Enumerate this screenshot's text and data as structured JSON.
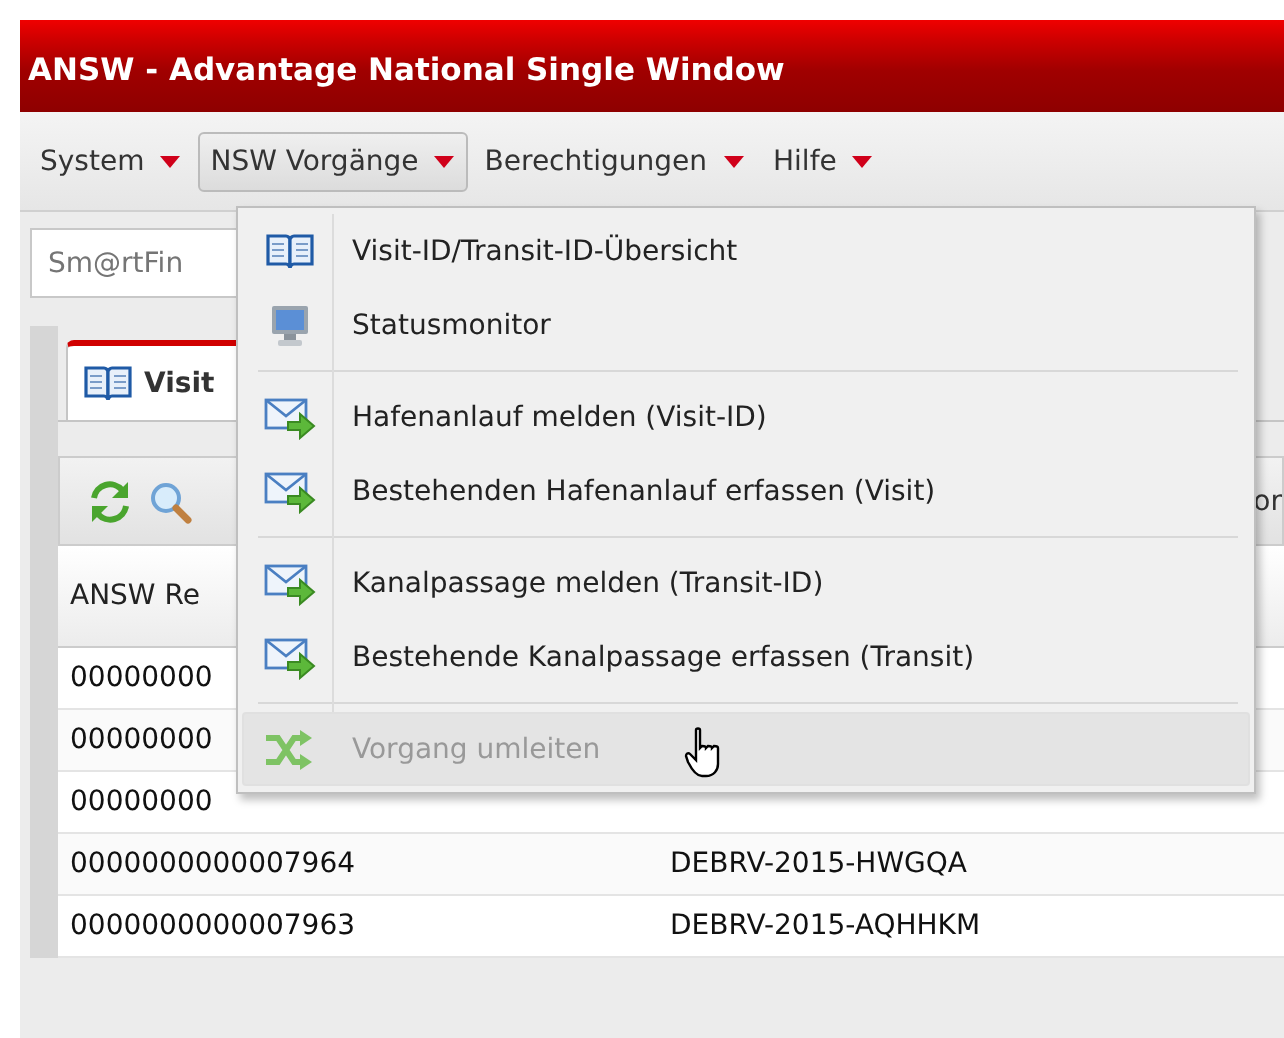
{
  "window": {
    "title": "ANSW - Advantage National Single Window"
  },
  "menubar": [
    {
      "label": "System",
      "selected": false
    },
    {
      "label": "NSW Vorgänge",
      "selected": true
    },
    {
      "label": "Berechtigungen",
      "selected": false
    },
    {
      "label": "Hilfe",
      "selected": false
    }
  ],
  "search": {
    "placeholder": "Sm@rtFin"
  },
  "tab": {
    "label": "Visit"
  },
  "toolbar": {
    "text": "or"
  },
  "table": {
    "columns": [
      "ANSW Re"
    ],
    "rows": [
      [
        "00000000"
      ],
      [
        "00000000"
      ],
      [
        "00000000"
      ],
      [
        "0000000000007964",
        "DEBRV-2015-HWGQA"
      ],
      [
        "0000000000007963",
        "DEBRV-2015-AQHHKM"
      ]
    ]
  },
  "dropdown": [
    {
      "kind": "book",
      "label": "Visit-ID/Transit-ID-Übersicht",
      "disabled": false,
      "highlighted": false
    },
    {
      "kind": "monitor",
      "label": "Statusmonitor",
      "disabled": false,
      "highlighted": false
    },
    {
      "kind": "separator"
    },
    {
      "kind": "mail",
      "label": "Hafenanlauf melden (Visit-ID)",
      "disabled": false,
      "highlighted": false
    },
    {
      "kind": "mail",
      "label": "Bestehenden Hafenanlauf erfassen (Visit)",
      "disabled": false,
      "highlighted": false
    },
    {
      "kind": "separator"
    },
    {
      "kind": "mail",
      "label": "Kanalpassage melden (Transit-ID)",
      "disabled": false,
      "highlighted": false
    },
    {
      "kind": "mail",
      "label": "Bestehende Kanalpassage erfassen (Transit)",
      "disabled": false,
      "highlighted": false
    },
    {
      "kind": "separator"
    },
    {
      "kind": "shuffle",
      "label": "Vorgang umleiten",
      "disabled": true,
      "highlighted": true
    }
  ]
}
